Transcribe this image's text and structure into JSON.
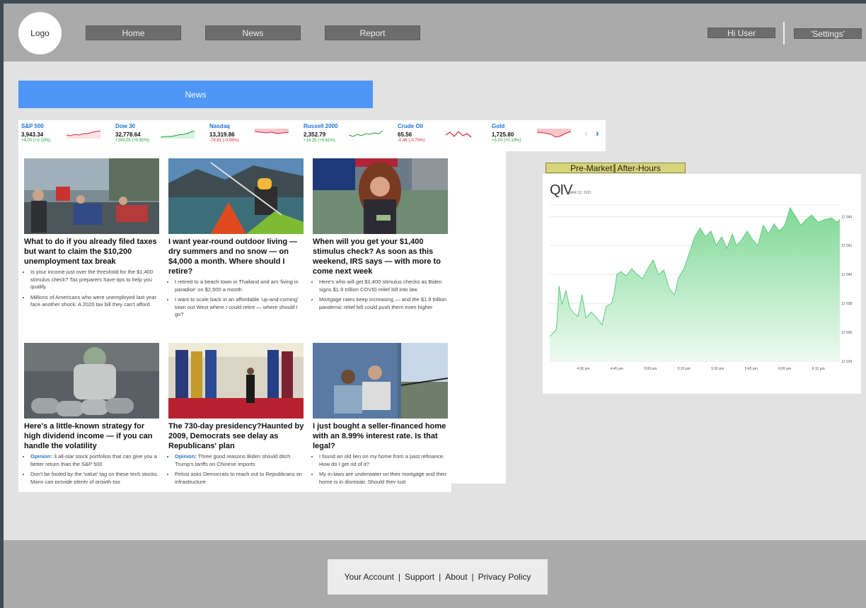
{
  "header": {
    "logo": "Logo",
    "nav": [
      "Home",
      "News",
      "Report"
    ],
    "greeting": "Hi User",
    "settings": "'Settings'"
  },
  "news_bar": "News",
  "ticker": [
    {
      "name": "S&P 500",
      "value": "3,943.34",
      "change": "+4.00 (+0.10%)",
      "dir": "up"
    },
    {
      "name": "Dow 30",
      "value": "32,778.64",
      "change": "+293.05 (+0.90%)",
      "dir": "up"
    },
    {
      "name": "Nasdaq",
      "value": "13,319.86",
      "change": "-78.81 (-0.59%)",
      "dir": "down"
    },
    {
      "name": "Russell 2000",
      "value": "2,352.79",
      "change": "+14.25 (+0.61%)",
      "dir": "up"
    },
    {
      "name": "Crude Oil",
      "value": "65.56",
      "change": "-0.46 (-0.70%)",
      "dir": "down"
    },
    {
      "name": "Gold",
      "value": "1,725.80",
      "change": "+3.20 (+0.19%)",
      "dir": "up"
    }
  ],
  "articles": [
    {
      "headline": "What to do if you already filed taxes but want to claim the $10,200 unemployment tax break",
      "bullets": [
        {
          "opinion": "",
          "text": "Is your income just over the threshold for the $1,400 stimulus check? Tax preparers have tips to help you qualify."
        },
        {
          "opinion": "",
          "text": "Millions of Americans who were unemployed last year face another shock: A 2020 tax bill they can't afford"
        }
      ]
    },
    {
      "headline": "I want year-round outdoor living — dry summers and no snow — on $4,000 a month. Where should I retire?",
      "bullets": [
        {
          "opinion": "",
          "text": "I retired to a beach town in Thailand and am 'living in paradise' on $2,500 a month"
        },
        {
          "opinion": "",
          "text": "I want to scale back in an affordable 'up-and-coming' town out West where I could retire — where should I go?"
        }
      ]
    },
    {
      "headline": "When will you get your $1,400 stimulus check? As soon as this weekend, IRS says — with more to come next week",
      "bullets": [
        {
          "opinion": "",
          "text": "Here's who will get $1,400 stimulus checks as Biden signs $1.9 trillion COVID relief bill into law"
        },
        {
          "opinion": "",
          "text": "Mortgage rates keep increasing — and the $1.9 trillion pandemic relief bill could push them even higher"
        }
      ]
    },
    {
      "headline": "Here's a little-known strategy for high dividend income — if you can handle the volatility",
      "bullets": [
        {
          "opinion": "Opinion:",
          "text": " 3 all-star stock portfolios that can give you a better return than the S&P 500"
        },
        {
          "opinion": "",
          "text": "Don't be fooled by the 'value' tag on these tech stocks. Many can provide plenty of growth too"
        }
      ]
    },
    {
      "headline": "The 730-day presidency?Haunted by 2009, Democrats see delay as Republicans' plan",
      "bullets": [
        {
          "opinion": "Opinion:",
          "text": " Three good reasons Biden should ditch Trump's tariffs on Chinese imports"
        },
        {
          "opinion": "",
          "text": "Pelosi asks Democrats to reach out to Republicans on infrastructure"
        }
      ]
    },
    {
      "headline": "I just bought a seller-financed home with an 8.99% interest rate. Is that legal?",
      "bullets": [
        {
          "opinion": "",
          "text": "I found an old lien on my home from a past refinance. How do I get rid of it?"
        },
        {
          "opinion": "",
          "text": "My in-laws are underwater on their mortgage and their home is in disrepair. Should they just"
        }
      ]
    }
  ],
  "market_toggle": {
    "pre": "Pre-Market",
    "after": "After-Hours"
  },
  "chart_panel": {
    "symbol": "QIV",
    "date": "MAR 12, 2021"
  },
  "chart_data": {
    "type": "area",
    "x": [
      "4:30 pm",
      "4:45 pm",
      "5:00 pm",
      "5:15 pm",
      "5:30 pm",
      "5:45 pm",
      "6:00 pm",
      "6:15 pm"
    ],
    "y_ticks": [
      12934,
      12936,
      12938,
      12940,
      12942,
      12944
    ],
    "y_tick_labels": [
      "12 934",
      "12 936",
      "12 938",
      "12 940",
      "12 942",
      "12 944"
    ],
    "ylim": [
      12934,
      12944.6
    ],
    "x_range": [
      4.25,
      6.41
    ],
    "series": [
      {
        "color": "#7fd896",
        "points": [
          [
            4.25,
            12935.7
          ],
          [
            4.3,
            12936.2
          ],
          [
            4.32,
            12939.2
          ],
          [
            4.34,
            12937.9
          ],
          [
            4.37,
            12938.9
          ],
          [
            4.4,
            12937.7
          ],
          [
            4.43,
            12937.3
          ],
          [
            4.46,
            12937.1
          ],
          [
            4.49,
            12938.6
          ],
          [
            4.52,
            12937.0
          ],
          [
            4.56,
            12937.4
          ],
          [
            4.6,
            12937.0
          ],
          [
            4.64,
            12936.5
          ],
          [
            4.67,
            12937.8
          ],
          [
            4.71,
            12938.0
          ],
          [
            4.73,
            12938.7
          ],
          [
            4.75,
            12940.0
          ],
          [
            4.78,
            12940.2
          ],
          [
            4.82,
            12939.9
          ],
          [
            4.86,
            12940.4
          ],
          [
            4.9,
            12940.0
          ],
          [
            4.94,
            12939.7
          ],
          [
            4.98,
            12940.4
          ],
          [
            5.02,
            12941.0
          ],
          [
            5.06,
            12940.0
          ],
          [
            5.1,
            12940.3
          ],
          [
            5.14,
            12939.0
          ],
          [
            5.18,
            12938.6
          ],
          [
            5.21,
            12939.8
          ],
          [
            5.25,
            12940.4
          ],
          [
            5.29,
            12941.5
          ],
          [
            5.33,
            12942.6
          ],
          [
            5.37,
            12943.2
          ],
          [
            5.41,
            12942.6
          ],
          [
            5.45,
            12943.0
          ],
          [
            5.49,
            12942.0
          ],
          [
            5.53,
            12942.6
          ],
          [
            5.57,
            12941.8
          ],
          [
            5.61,
            12942.8
          ],
          [
            5.64,
            12942.0
          ],
          [
            5.68,
            12942.4
          ],
          [
            5.72,
            12943.0
          ],
          [
            5.76,
            12942.4
          ],
          [
            5.8,
            12942.0
          ],
          [
            5.84,
            12943.4
          ],
          [
            5.88,
            12942.8
          ],
          [
            5.92,
            12943.5
          ],
          [
            5.96,
            12943.0
          ],
          [
            6.0,
            12943.4
          ],
          [
            6.04,
            12944.6
          ],
          [
            6.08,
            12944.0
          ],
          [
            6.12,
            12943.4
          ],
          [
            6.16,
            12943.8
          ],
          [
            6.2,
            12944.1
          ],
          [
            6.25,
            12943.6
          ],
          [
            6.3,
            12943.8
          ],
          [
            6.35,
            12943.9
          ],
          [
            6.39,
            12943.6
          ],
          [
            6.41,
            12943.8
          ]
        ]
      }
    ],
    "grid": true
  },
  "footer": {
    "links": [
      "Your Account",
      "Support",
      "About",
      "Privacy Policy"
    ]
  },
  "colors": {
    "accent": "#4e97f7",
    "up": "#1f9a3a",
    "down": "#d3263a",
    "area": "#7fd896"
  }
}
